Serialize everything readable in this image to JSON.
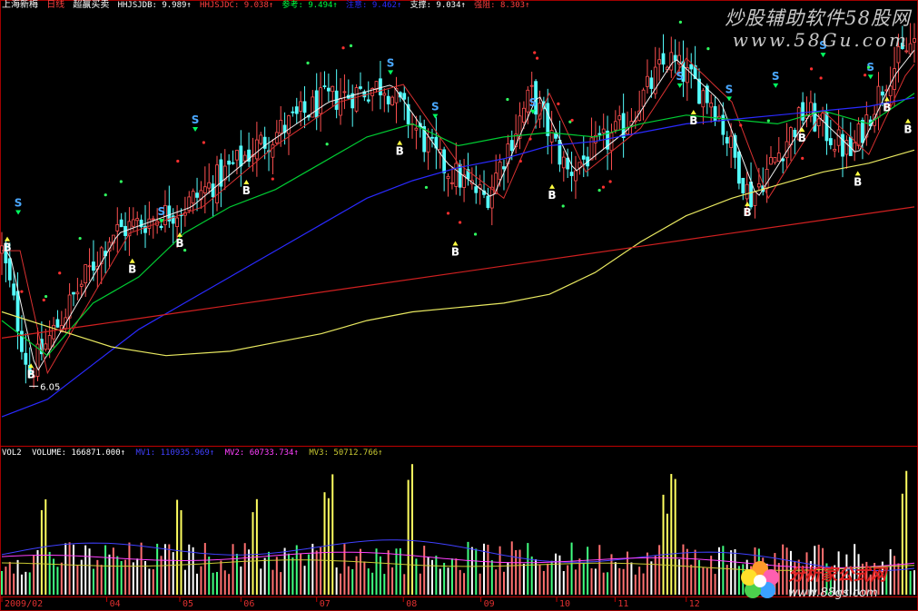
{
  "header": {
    "stock": "上海新梅",
    "period": "日线",
    "indicator": "超赢买卖",
    "items": [
      {
        "label": "HHJSJDB: 9.989↑",
        "color": "#ffffff"
      },
      {
        "label": "HHJSJDC: 9.038↑",
        "color": "#ff4040"
      },
      {
        "label": "参考: 9.494↑",
        "color": "#00ff40"
      },
      {
        "label": "注意: 9.462↑",
        "color": "#2a2aff"
      },
      {
        "label": "支撑: 9.034↑",
        "color": "#ffffff"
      },
      {
        "label": "强阻: 8.303↑",
        "color": "#ff4040"
      }
    ]
  },
  "volume_header": {
    "name": "VOL2",
    "items": [
      {
        "label": "VOLUME: 166871.000↑",
        "color": "#ffffff"
      },
      {
        "label": "MV1: 110935.969↑",
        "color": "#4040ff"
      },
      {
        "label": "MV2: 60733.734↑",
        "color": "#ff40ff"
      },
      {
        "label": "MV3: 50712.766↑",
        "color": "#c8c832"
      }
    ]
  },
  "watermarks": {
    "top_cn": "炒股辅助软件58股网",
    "top_url": "www.58Gu.com",
    "bottom_cn": "分析家公式网",
    "bottom_url": "www.88gs.com"
  },
  "chart_data": {
    "type": "candlestick",
    "x_ticks": [
      "2009/02",
      "04",
      "05",
      "06",
      "07",
      "08",
      "09",
      "10",
      "11",
      "12"
    ],
    "low_label": "6.05",
    "y_range": [
      5.4,
      10.3
    ],
    "key_points": [
      {
        "x": 0.0,
        "price": 7.6
      },
      {
        "x": 0.03,
        "price": 6.2
      },
      {
        "x": 0.12,
        "price": 7.8
      },
      {
        "x": 0.2,
        "price": 8.1
      },
      {
        "x": 0.28,
        "price": 8.8
      },
      {
        "x": 0.35,
        "price": 9.3
      },
      {
        "x": 0.42,
        "price": 9.5
      },
      {
        "x": 0.48,
        "price": 8.6
      },
      {
        "x": 0.53,
        "price": 8.2
      },
      {
        "x": 0.58,
        "price": 9.4
      },
      {
        "x": 0.62,
        "price": 8.5
      },
      {
        "x": 0.68,
        "price": 9.0
      },
      {
        "x": 0.73,
        "price": 9.8
      },
      {
        "x": 0.78,
        "price": 9.3
      },
      {
        "x": 0.82,
        "price": 8.2
      },
      {
        "x": 0.88,
        "price": 9.2
      },
      {
        "x": 0.93,
        "price": 8.7
      },
      {
        "x": 0.97,
        "price": 9.6
      },
      {
        "x": 1.0,
        "price": 10.0
      }
    ],
    "signals": [
      {
        "type": "S",
        "x": 0.018,
        "price": 8.0
      },
      {
        "type": "B",
        "x": 0.006,
        "price": 7.75
      },
      {
        "type": "B",
        "x": 0.032,
        "price": 6.3
      },
      {
        "type": "S",
        "x": 0.175,
        "price": 7.9
      },
      {
        "type": "B",
        "x": 0.143,
        "price": 7.5
      },
      {
        "type": "B",
        "x": 0.195,
        "price": 7.8
      },
      {
        "type": "S",
        "x": 0.212,
        "price": 8.95
      },
      {
        "type": "B",
        "x": 0.268,
        "price": 8.4
      },
      {
        "type": "S",
        "x": 0.426,
        "price": 9.6
      },
      {
        "type": "B",
        "x": 0.436,
        "price": 8.85
      },
      {
        "type": "S",
        "x": 0.475,
        "price": 9.1
      },
      {
        "type": "B",
        "x": 0.497,
        "price": 7.7
      },
      {
        "type": "S",
        "x": 0.582,
        "price": 9.15
      },
      {
        "type": "B",
        "x": 0.603,
        "price": 8.35
      },
      {
        "type": "S",
        "x": 0.743,
        "price": 9.45
      },
      {
        "type": "B",
        "x": 0.758,
        "price": 9.2
      },
      {
        "type": "S",
        "x": 0.797,
        "price": 9.3
      },
      {
        "type": "B",
        "x": 0.817,
        "price": 8.15
      },
      {
        "type": "S",
        "x": 0.848,
        "price": 9.45
      },
      {
        "type": "B",
        "x": 0.877,
        "price": 9.0
      },
      {
        "type": "S",
        "x": 0.9,
        "price": 9.8
      },
      {
        "type": "B",
        "x": 0.938,
        "price": 8.5
      },
      {
        "type": "S",
        "x": 0.952,
        "price": 9.55
      },
      {
        "type": "B",
        "x": 0.97,
        "price": 9.35
      },
      {
        "type": "B",
        "x": 0.993,
        "price": 9.1
      }
    ],
    "ma_lines": [
      {
        "name": "参考",
        "color": "#00cc33",
        "points": [
          [
            0,
            6.8
          ],
          [
            0.05,
            6.4
          ],
          [
            0.1,
            7.0
          ],
          [
            0.15,
            7.3
          ],
          [
            0.2,
            7.8
          ],
          [
            0.25,
            8.1
          ],
          [
            0.3,
            8.3
          ],
          [
            0.35,
            8.6
          ],
          [
            0.4,
            8.9
          ],
          [
            0.45,
            9.05
          ],
          [
            0.5,
            8.8
          ],
          [
            0.55,
            8.9
          ],
          [
            0.6,
            8.95
          ],
          [
            0.65,
            8.9
          ],
          [
            0.7,
            9.05
          ],
          [
            0.75,
            9.15
          ],
          [
            0.8,
            9.1
          ],
          [
            0.85,
            9.05
          ],
          [
            0.9,
            9.2
          ],
          [
            0.95,
            9.05
          ],
          [
            1.0,
            9.4
          ]
        ]
      },
      {
        "name": "注意",
        "color": "#2a2aff",
        "points": [
          [
            0,
            5.7
          ],
          [
            0.05,
            5.9
          ],
          [
            0.1,
            6.3
          ],
          [
            0.15,
            6.7
          ],
          [
            0.2,
            7.0
          ],
          [
            0.25,
            7.3
          ],
          [
            0.3,
            7.6
          ],
          [
            0.35,
            7.9
          ],
          [
            0.4,
            8.2
          ],
          [
            0.45,
            8.4
          ],
          [
            0.5,
            8.55
          ],
          [
            0.55,
            8.65
          ],
          [
            0.6,
            8.8
          ],
          [
            0.65,
            8.85
          ],
          [
            0.7,
            8.95
          ],
          [
            0.75,
            9.05
          ],
          [
            0.8,
            9.1
          ],
          [
            0.85,
            9.15
          ],
          [
            0.9,
            9.2
          ],
          [
            0.95,
            9.25
          ],
          [
            1.0,
            9.35
          ]
        ]
      },
      {
        "name": "支撑",
        "color": "#e8e860",
        "points": [
          [
            0,
            6.9
          ],
          [
            0.06,
            6.7
          ],
          [
            0.12,
            6.5
          ],
          [
            0.18,
            6.4
          ],
          [
            0.25,
            6.45
          ],
          [
            0.3,
            6.55
          ],
          [
            0.35,
            6.65
          ],
          [
            0.4,
            6.8
          ],
          [
            0.45,
            6.9
          ],
          [
            0.5,
            6.95
          ],
          [
            0.55,
            7.0
          ],
          [
            0.6,
            7.1
          ],
          [
            0.65,
            7.35
          ],
          [
            0.7,
            7.7
          ],
          [
            0.75,
            8.0
          ],
          [
            0.8,
            8.2
          ],
          [
            0.85,
            8.35
          ],
          [
            0.9,
            8.5
          ],
          [
            0.95,
            8.6
          ],
          [
            1.0,
            8.75
          ]
        ]
      },
      {
        "name": "强阻",
        "color": "#d02020",
        "points": [
          [
            0,
            6.6
          ],
          [
            0.1,
            6.75
          ],
          [
            0.2,
            6.9
          ],
          [
            0.3,
            7.05
          ],
          [
            0.4,
            7.2
          ],
          [
            0.5,
            7.35
          ],
          [
            0.6,
            7.5
          ],
          [
            0.7,
            7.65
          ],
          [
            0.8,
            7.8
          ],
          [
            0.9,
            7.95
          ],
          [
            1.0,
            8.1
          ]
        ]
      }
    ],
    "volume_tall_bars": [
      0.045,
      0.196,
      0.276,
      0.356,
      0.36,
      0.447,
      0.726,
      0.735,
      0.99
    ]
  }
}
